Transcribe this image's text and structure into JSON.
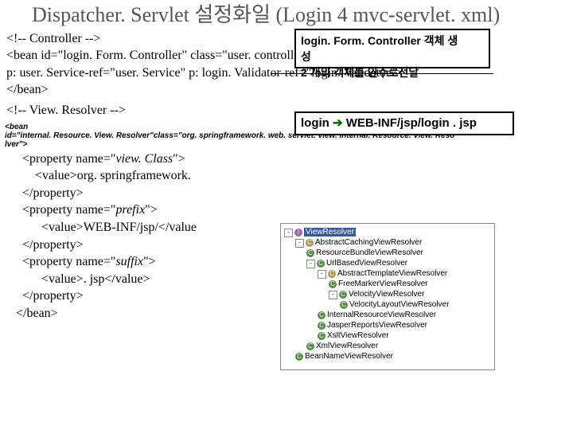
{
  "title": "Dispatcher. Servlet 설정화일 (Login 4 mvc-servlet. xml)",
  "callout1_line1": "login. Form. Controller 객체 생",
  "callout1_line2": "성",
  "callout1_line3": "2 개의 객체를 인수로전달",
  "code1_l1": "<!-- Controller -->",
  "code1_l2a": "<bean id=\"login. Form. Controller\" class=\"user. controller. Login. Form. Controller\"",
  "code1_l3": "  p: user. Service-ref=\"user. Service\" p: login. Validator-ref=\"login. Validator\">",
  "code1_l4": "</bean>",
  "callout2_a": "login",
  "callout2_arrow": " ➔ ",
  "callout2_b": "WEB-INF/jsp/login . jsp",
  "code2_l1": "<!-- View. Resolver -->",
  "small_l1": "<bean",
  "small_l2": "id=\"internal. Resource. View. Resolver\"class=\"org. springframework. web. servlet. view. Internal. Resource. View. Reso",
  "small_l3": "lver\">",
  "prop1_a": "<property name=\"",
  "prop1_b": "view. Class",
  "prop1_c": "\">",
  "val1": "<value>org. springframework.",
  "close1": "</property>",
  "prop2_a": "<property name=\"",
  "prop2_b": "prefix",
  "prop2_c": "\">",
  "val2": "<value>WEB-INF/jsp/</value",
  "close2": "</property>",
  "prop3_a": "<property name=\"",
  "prop3_b": "suffix",
  "prop3_c": "\">",
  "val3": "<value>. jsp</value>",
  "close3": "</property>",
  "close_bean": "</bean>",
  "tree": {
    "root": "ViewResolver",
    "n1": "AbstractCachingViewResolver",
    "n2": "ResourceBundleViewResolver",
    "n3": "UrlBasedViewResolver",
    "n4": "AbstractTemplateViewResolver",
    "n5": "FreeMarkerViewResolver",
    "n6": "VelocityViewResolver",
    "n7": "VelocityLayoutViewResolver",
    "n8": "InternalResourceViewResolver",
    "n9": "JasperReportsViewResolver",
    "n10": "XsltViewResolver",
    "n11": "XmlViewResolver",
    "n12": "BeanNameViewResolver"
  }
}
